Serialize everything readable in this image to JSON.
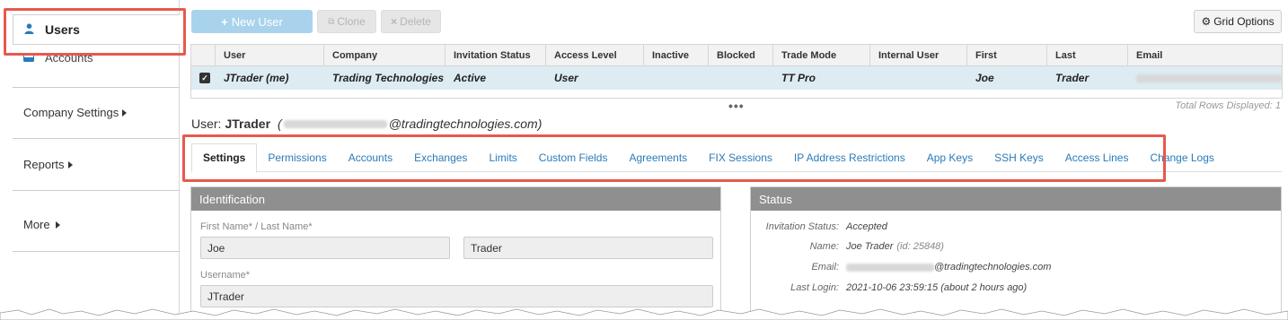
{
  "sidebar": {
    "users_label": "Users",
    "accounts_label": "Accounts",
    "company_settings_label": "Company Settings",
    "reports_label": "Reports",
    "more_label": "More"
  },
  "toolbar": {
    "new_user_label": "New User",
    "clone_label": "Clone",
    "delete_label": "Delete",
    "grid_options_label": "Grid Options"
  },
  "grid": {
    "columns": [
      "User",
      "Company",
      "Invitation Status",
      "Access Level",
      "Inactive",
      "Blocked",
      "Trade Mode",
      "Internal User",
      "First",
      "Last",
      "Email"
    ],
    "row": {
      "user": "JTrader (me)",
      "company": "Trading Technologies",
      "invitation_status": "Active",
      "access_level": "User",
      "inactive": "",
      "blocked": "",
      "trade_mode": "TT Pro",
      "internal_user": "",
      "first": "Joe",
      "last": "Trader",
      "email": ""
    },
    "total_rows": "Total Rows Displayed: 1",
    "ellipsis": "•••"
  },
  "user_header": {
    "prefix": "User:",
    "username": "JTrader",
    "email_open": "(",
    "email_domain": "@tradingtechnologies.com)"
  },
  "tabs": [
    "Settings",
    "Permissions",
    "Accounts",
    "Exchanges",
    "Limits",
    "Custom Fields",
    "Agreements",
    "FIX Sessions",
    "IP Address Restrictions",
    "App Keys",
    "SSH Keys",
    "Access Lines",
    "Change Logs"
  ],
  "identification": {
    "title": "Identification",
    "name_label": "First Name* / Last Name*",
    "first_name": "Joe",
    "last_name": "Trader",
    "username_label": "Username*",
    "username": "JTrader"
  },
  "status": {
    "title": "Status",
    "invitation_key": "Invitation Status:",
    "invitation_value": "Accepted",
    "name_key": "Name:",
    "name_value": "Joe Trader",
    "name_id": "(id: 25848)",
    "email_key": "Email:",
    "email_domain": "@tradingtechnologies.com",
    "last_login_key": "Last Login:",
    "last_login_value": "2021-10-06 23:59:15 (about 2 hours ago)"
  },
  "colors": {
    "highlight": "#e55a4e",
    "link": "#2a7ab8",
    "selected_row": "#ddebf2",
    "panel_header": "#8f8f8f",
    "new_button": "#a9d3ec"
  }
}
